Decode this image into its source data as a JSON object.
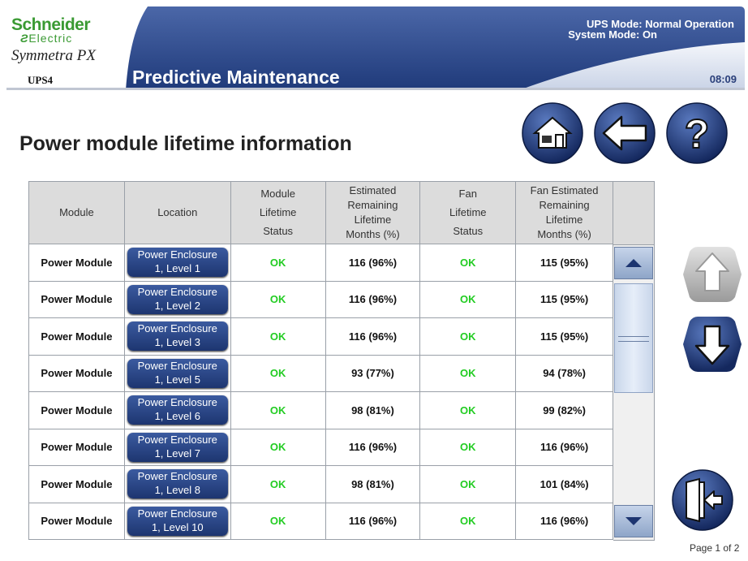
{
  "header": {
    "brand_line1": "Schneider",
    "brand_line2": "Electric",
    "product": "Symmetra PX",
    "unit": "UPS4",
    "title": "Predictive Maintenance",
    "ups_mode": "UPS Mode: Normal Operation",
    "system_mode": "System Mode: On",
    "clock": "08:09"
  },
  "page_heading": "Power module lifetime information",
  "nav": {
    "home_icon": "home-icon",
    "back_icon": "back-arrow-icon",
    "help_icon": "help-icon",
    "up_icon": "up-arrow-icon",
    "down_icon": "down-arrow-icon",
    "exit_icon": "exit-door-icon"
  },
  "table": {
    "headers": {
      "module": "Module",
      "location": "Location",
      "module_status_l1": "Module",
      "module_status_l2": "Lifetime",
      "module_status_l3": "Status",
      "est_l1": "Estimated",
      "est_l2": "Remaining",
      "est_l3": "Lifetime",
      "est_l4": "Months (%)",
      "fan_status_l1": "Fan",
      "fan_status_l2": "Lifetime",
      "fan_status_l3": "Status",
      "fan_est_l1": "Fan Estimated",
      "fan_est_l2": "Remaining",
      "fan_est_l3": "Lifetime",
      "fan_est_l4": "Months (%)"
    },
    "rows": [
      {
        "module": "Power Module",
        "loc1": "Power Enclosure",
        "loc2": "1, Level 1",
        "status": "OK",
        "est": "116 (96%)",
        "fan_status": "OK",
        "fan_est": "115 (95%)"
      },
      {
        "module": "Power Module",
        "loc1": "Power Enclosure",
        "loc2": "1, Level 2",
        "status": "OK",
        "est": "116 (96%)",
        "fan_status": "OK",
        "fan_est": "115 (95%)"
      },
      {
        "module": "Power Module",
        "loc1": "Power Enclosure",
        "loc2": "1, Level 3",
        "status": "OK",
        "est": "116 (96%)",
        "fan_status": "OK",
        "fan_est": "115 (95%)"
      },
      {
        "module": "Power Module",
        "loc1": "Power Enclosure",
        "loc2": "1, Level 5",
        "status": "OK",
        "est": "93 (77%)",
        "fan_status": "OK",
        "fan_est": "94 (78%)"
      },
      {
        "module": "Power Module",
        "loc1": "Power Enclosure",
        "loc2": "1, Level 6",
        "status": "OK",
        "est": "98 (81%)",
        "fan_status": "OK",
        "fan_est": "99 (82%)"
      },
      {
        "module": "Power Module",
        "loc1": "Power Enclosure",
        "loc2": "1, Level 7",
        "status": "OK",
        "est": "116 (96%)",
        "fan_status": "OK",
        "fan_est": "116 (96%)"
      },
      {
        "module": "Power Module",
        "loc1": "Power Enclosure",
        "loc2": "1, Level 8",
        "status": "OK",
        "est": "98 (81%)",
        "fan_status": "OK",
        "fan_est": "101 (84%)"
      },
      {
        "module": "Power Module",
        "loc1": "Power Enclosure",
        "loc2": "1, Level 10",
        "status": "OK",
        "est": "116 (96%)",
        "fan_status": "OK",
        "fan_est": "116 (96%)"
      }
    ]
  },
  "page_indicator": "Page 1 of 2",
  "colors": {
    "header_blue": "#2b4a8c",
    "ok_green": "#22cc22",
    "brand_green": "#3a9a33",
    "button_blue": "#1d3570"
  }
}
